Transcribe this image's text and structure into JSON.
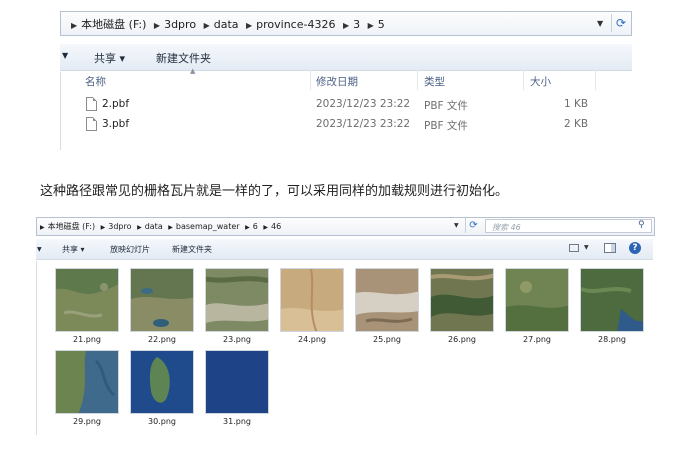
{
  "window1": {
    "breadcrumb": [
      "本地磁盘 (F:)",
      "3dpro",
      "data",
      "province-4326",
      "3",
      "5"
    ],
    "toolbar": {
      "share_label": "共享 ▾",
      "new_folder_label": "新建文件夹"
    },
    "columns": {
      "name": "名称",
      "date": "修改日期",
      "type": "类型",
      "size": "大小"
    },
    "files": [
      {
        "name": "2.pbf",
        "date": "2023/12/23 23:22",
        "type": "PBF 文件",
        "size": "1 KB"
      },
      {
        "name": "3.pbf",
        "date": "2023/12/23 23:22",
        "type": "PBF 文件",
        "size": "2 KB"
      }
    ]
  },
  "caption": "这种路径跟常见的栅格瓦片就是一样的了，可以采用同样的加载规则进行初始化。",
  "window2": {
    "breadcrumb": [
      "本地磁盘 (F:)",
      "3dpro",
      "data",
      "basemap_water",
      "6",
      "46"
    ],
    "search_placeholder": "搜索 46",
    "toolbar": {
      "share_label": "共享 ▾",
      "slideshow_label": "放映幻灯片",
      "new_folder_label": "新建文件夹"
    },
    "thumbnails": [
      {
        "name": "21.png",
        "color": "#5e7a4c"
      },
      {
        "name": "22.png",
        "color": "#64764f"
      },
      {
        "name": "23.png",
        "color": "#7e8a64"
      },
      {
        "name": "24.png",
        "color": "#c7aa7e"
      },
      {
        "name": "25.png",
        "color": "#a89378"
      },
      {
        "name": "26.png",
        "color": "#6f7650"
      },
      {
        "name": "27.png",
        "color": "#6f8452"
      },
      {
        "name": "28.png",
        "color": "#4d6b3e"
      },
      {
        "name": "29.png",
        "color": "#3f6a8c"
      },
      {
        "name": "30.png",
        "color": "#1f4b8c"
      },
      {
        "name": "31.png",
        "color": "#1c3f82"
      }
    ]
  }
}
